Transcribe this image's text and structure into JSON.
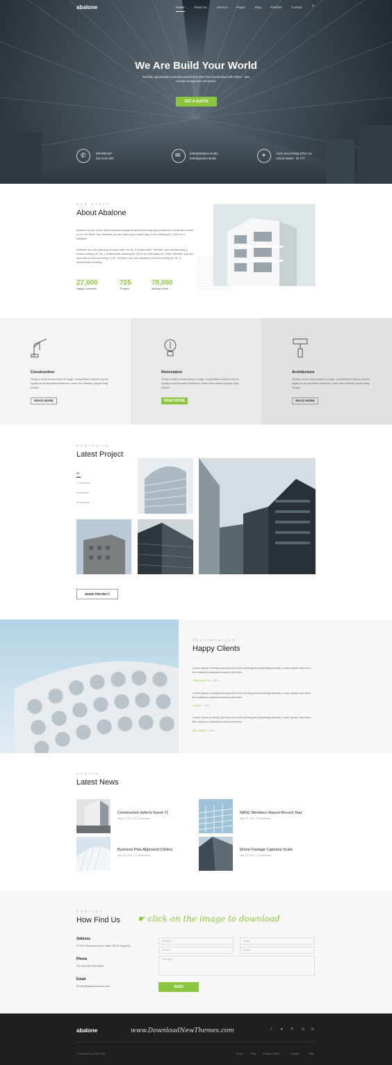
{
  "header": {
    "logo": "abalone",
    "nav": [
      "Home",
      "About Us",
      "Service",
      "Pages",
      "Blog",
      "Portfolio",
      "Contact"
    ]
  },
  "hero": {
    "title": "We Are Build Your World",
    "subtitle_1": "Random opportunities and discoveries that arise from interactions with others - also",
    "subtitle_2": "reveals unexpected connection",
    "cta": "GET A QUOTE",
    "contacts": [
      {
        "icon": "phone-icon",
        "lines": [
          "090 096 687",
          "012 2134 832"
        ]
      },
      {
        "icon": "mail-icon",
        "lines": [
          "hello@abalone.studio",
          "hello@gambo.studio"
        ]
      },
      {
        "icon": "location-icon",
        "lines": [
          "Carly Jean Rohrig 6752 Ave",
          "United States - 04 777"
        ]
      }
    ]
  },
  "about": {
    "tag": "OUR STORY",
    "title": "About Abalone",
    "p1": "Abalone is one of the most luxurious designed and technologically enhanced convention center in Ho Chi Minh City. Whether you are planning a board ting for 30 meeting for 3,500 or a banquet.",
    "p2": "Whether you are planning a board meet for 30, a shareholder. Whether you are planning a board meeting for 30, a shareholder meeting for 3,500 or a banquet for 3,500. Whether you are planning a board meeting for 30. Whether you are planning a board meeting for 30, a shareholder meeting.",
    "stats": [
      {
        "value": "27,000",
        "label": "Happy Customers"
      },
      {
        "value": "725",
        "label": "Projects"
      },
      {
        "value": "78,000",
        "label": "Working Hours"
      }
    ]
  },
  "services": [
    {
      "icon": "crane-icon",
      "title": "Construction",
      "text": "Today's retail environment is tough, competition is fierce stomer loyalty is an important business, come from fewest people bing hinges.",
      "btn": "READ MORE"
    },
    {
      "icon": "bulb-icon",
      "title": "Renovation",
      "text": "Today's retail environment is tough, competition is fierce stomer loyalty is an important business, come from fewest people bing hinges.",
      "btn": "READ MORE"
    },
    {
      "icon": "paint-roller-icon",
      "title": "Architecture",
      "text": "Today's retail environment is tough, competition is fierce stomer loyalty is an important business, come from fewest people bing hinges.",
      "btn": "READ MORE"
    }
  ],
  "portfolio": {
    "tag": "PORTFOLIO",
    "title": "Latest Project",
    "filters": [
      "All",
      "Construction",
      "Renovation",
      "Architecture"
    ],
    "more": "MORE PROJECT"
  },
  "testimonials": {
    "tag": "TESTIMONIALS",
    "title": "Happy Clients",
    "items": [
      {
        "text": "Lorem Ipsum is simply dummy text of the printing and pesetting industry. Lorem Ipsum has been the industry's standard dummy text ever.",
        "name": "FARIS BOSTON",
        "role": "- CEO"
      },
      {
        "text": "Lorem Ipsum is simply dummy text of the printing and pesetting industry. Lorem Ipsum has been the industry's standard dummy text ever.",
        "name": "CALVEY",
        "role": "- CEO"
      },
      {
        "text": "Lorem Ipsum is simply dummy text of the printing and pesetting industry. Lorem Ipsum has been the industry's standard dummy text ever.",
        "name": "MRT CREAT",
        "role": "- CEO"
      }
    ]
  },
  "news": {
    "tag": "UPDATE",
    "title": "Latest News",
    "items": [
      {
        "title": "Construction defects found 71",
        "date": "May 24, 2017",
        "comments": "12 Comments"
      },
      {
        "title": "NASC Members Report Record Year",
        "date": "May 24, 2017",
        "comments": "9 Comments"
      },
      {
        "title": "Business Plan Approved Colliery",
        "date": "May 24, 2017",
        "comments": "27 Comments"
      },
      {
        "title": "Drone Footage Captures Scale",
        "date": "May 24, 2017",
        "comments": "3 Comments"
      }
    ]
  },
  "contact": {
    "tag": "CONTACT",
    "title": "How Find Us",
    "promo": "click on the image to download",
    "address_label": "Address",
    "address": "2301 Rosecrans Ave, Suite 200 El Segundo",
    "phone_label": "Phone",
    "phone": "(+84) 090 0190 6687",
    "email_label": "Email",
    "email": "hello@abalonetheme.com",
    "ph_subject": "Subject",
    "ph_name": "Name",
    "ph_phone": "Phone",
    "ph_email": "Email",
    "ph_message": "Message",
    "send": "SEND"
  },
  "footer": {
    "logo": "abalone",
    "watermark": "www.DownloadNewThemes.com",
    "copyright": "© Designed by ABALONE",
    "links": [
      "Home",
      "FAQ",
      "Privacy & Term",
      "Contact",
      "Help"
    ],
    "social": [
      "f",
      "♥",
      "P",
      "G",
      "in"
    ]
  }
}
